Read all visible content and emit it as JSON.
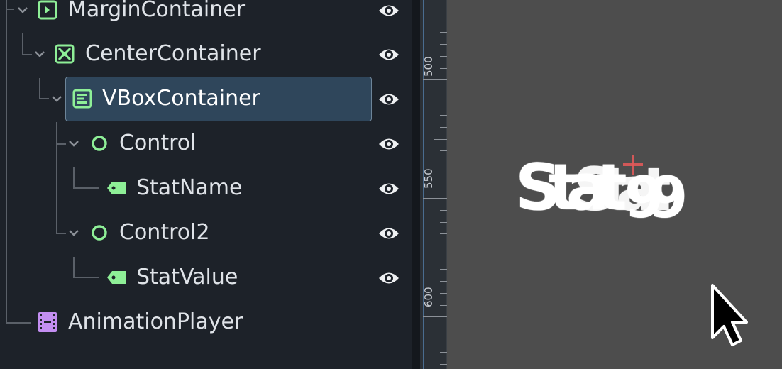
{
  "scene_tree": {
    "nodes": [
      {
        "name": "MarginContainer",
        "icon": "margin-container-icon",
        "selected": false
      },
      {
        "name": "CenterContainer",
        "icon": "center-container-icon",
        "selected": false
      },
      {
        "name": "VBoxContainer",
        "icon": "vbox-container-icon",
        "selected": true
      },
      {
        "name": "Control",
        "icon": "control-icon",
        "selected": false
      },
      {
        "name": "StatName",
        "icon": "label-icon",
        "selected": false
      },
      {
        "name": "Control2",
        "icon": "control-icon",
        "selected": false
      },
      {
        "name": "StatValue",
        "icon": "label-icon",
        "selected": false
      },
      {
        "name": "AnimationPlayer",
        "icon": "animation-player-icon",
        "selected": false
      }
    ]
  },
  "ruler": {
    "labels": [
      "500",
      "550",
      "600"
    ]
  },
  "viewport": {
    "overlapping_text_a": "Stat",
    "overlapping_text_b": "Stat",
    "overlapping_text_c": "99",
    "colors": {
      "background": "#4d4d4d",
      "text": "#ffffff",
      "crosshair": "#e05a5a"
    },
    "cursor_icon": "mouse-pointer-icon"
  },
  "colors": {
    "panel_bg": "#1d2229",
    "selection_bg": "#2f465b",
    "control_green": "#8eef97",
    "animation_purple": "#c38ef1",
    "text": "#dfe3e8"
  }
}
